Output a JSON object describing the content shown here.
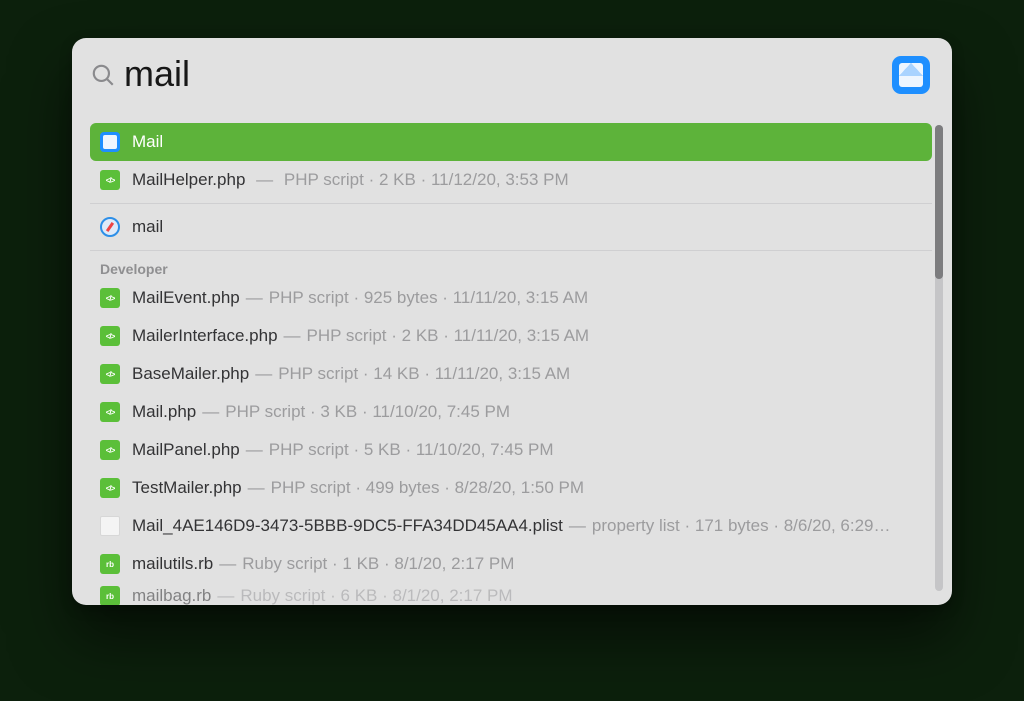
{
  "search": {
    "query": "mail"
  },
  "top_hit": {
    "name": "Mail"
  },
  "top_secondary": {
    "name": "MailHelper.php",
    "kind": "PHP script",
    "size": "2 KB",
    "date": "11/12/20, 3:53 PM"
  },
  "suggestion": {
    "name": "mail"
  },
  "sections": {
    "developer": "Developer"
  },
  "developer": [
    {
      "icon": "php",
      "name": "MailEvent.php",
      "kind": "PHP script",
      "size": "925 bytes",
      "date": "11/11/20, 3:15 AM"
    },
    {
      "icon": "php",
      "name": "MailerInterface.php",
      "kind": "PHP script",
      "size": "2 KB",
      "date": "11/11/20, 3:15 AM"
    },
    {
      "icon": "php",
      "name": "BaseMailer.php",
      "kind": "PHP script",
      "size": "14 KB",
      "date": "11/11/20, 3:15 AM"
    },
    {
      "icon": "php",
      "name": "Mail.php",
      "kind": "PHP script",
      "size": "3 KB",
      "date": "11/10/20, 7:45 PM"
    },
    {
      "icon": "php",
      "name": "MailPanel.php",
      "kind": "PHP script",
      "size": "5 KB",
      "date": "11/10/20, 7:45 PM"
    },
    {
      "icon": "php",
      "name": "TestMailer.php",
      "kind": "PHP script",
      "size": "499 bytes",
      "date": "8/28/20, 1:50 PM"
    },
    {
      "icon": "plist",
      "name": "Mail_4AE146D9-3473-5BBB-9DC5-FFA34DD45AA4.plist",
      "kind": "property list",
      "size": "171 bytes",
      "date": "8/6/20, 6:29…"
    },
    {
      "icon": "ruby",
      "name": "mailutils.rb",
      "kind": "Ruby script",
      "size": "1 KB",
      "date": "8/1/20, 2:17 PM"
    },
    {
      "icon": "ruby",
      "name": "mailbag.rb",
      "kind": "Ruby script",
      "size": "6 KB",
      "date": "8/1/20, 2:17 PM"
    }
  ]
}
